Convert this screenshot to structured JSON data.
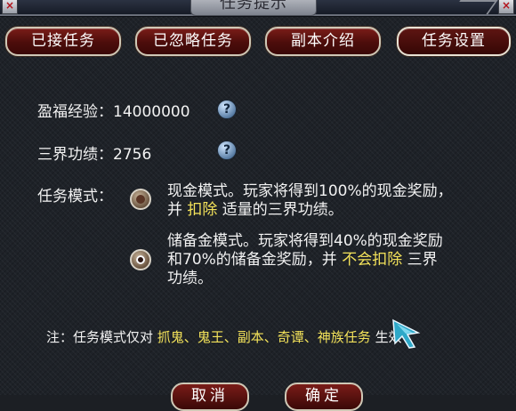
{
  "window": {
    "title": "任务提示",
    "close_left": "×",
    "close_right": "×"
  },
  "tabs": [
    {
      "label": "已接任务"
    },
    {
      "label": "已忽略任务"
    },
    {
      "label": "副本介绍"
    },
    {
      "label": "任务设置"
    }
  ],
  "bonus_exp": {
    "label": "盈福经验：",
    "value": "14000000"
  },
  "merit": {
    "label": "三界功绩：",
    "value": "2756"
  },
  "help_glyph": "?",
  "mode": {
    "label": "任务模式：",
    "cash": {
      "line1": "现金模式。玩家将得到100%的现金奖励，",
      "line2_pre": "并 ",
      "line2_hl": "扣除",
      "line2_post": " 适量的三界功绩。",
      "selected": false
    },
    "reserve": {
      "line1": "储备金模式。玩家将得到40%的现金奖励",
      "line2_pre": "和70%的储备金奖励，并 ",
      "line2_hl": "不会扣除",
      "line2_post": " 三界",
      "line3": "功绩。",
      "selected": true
    }
  },
  "note": {
    "pre": "注：任务模式仅对 ",
    "highlight": "抓鬼、鬼王、副本、奇谭、神族任务",
    "post": " 生效"
  },
  "buttons": {
    "cancel": "取消",
    "confirm": "确定"
  },
  "colors": {
    "highlight": "#f3e25a",
    "tab_fill": "#5e1512",
    "tab_border": "#cfc8b6"
  }
}
